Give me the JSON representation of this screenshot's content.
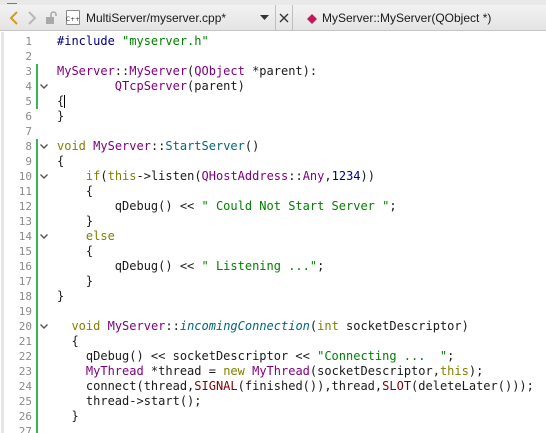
{
  "toolbar": {
    "file_name": "MultiServer/myserver.cpp*",
    "file_icon_text": "C++",
    "symbol": "MyServer::MyServer(QObject *)"
  },
  "lines": [
    {
      "n": "1",
      "change": false,
      "fold": false,
      "tokens": [
        {
          "t": "#include ",
          "c": "pp"
        },
        {
          "t": "\"myserver.h\"",
          "c": "pp-str"
        }
      ]
    },
    {
      "n": "2",
      "change": false,
      "fold": false,
      "tokens": []
    },
    {
      "n": "3",
      "change": true,
      "fold": false,
      "tokens": [
        {
          "t": "MyServer",
          "c": "type"
        },
        {
          "t": "::",
          "c": "plain"
        },
        {
          "t": "MyServer",
          "c": "type"
        },
        {
          "t": "(",
          "c": "plain"
        },
        {
          "t": "QObject",
          "c": "type"
        },
        {
          "t": " *parent):",
          "c": "plain"
        }
      ]
    },
    {
      "n": "4",
      "change": true,
      "fold": true,
      "tokens": [
        {
          "t": "        ",
          "c": "plain"
        },
        {
          "t": "QTcpServer",
          "c": "type"
        },
        {
          "t": "(parent)",
          "c": "plain"
        }
      ]
    },
    {
      "n": "5",
      "change": true,
      "fold": false,
      "cursor": true,
      "tokens": [
        {
          "t": "{",
          "c": "plain"
        }
      ]
    },
    {
      "n": "6",
      "change": false,
      "fold": false,
      "tokens": [
        {
          "t": "}",
          "c": "plain"
        }
      ]
    },
    {
      "n": "7",
      "change": false,
      "fold": false,
      "tokens": []
    },
    {
      "n": "8",
      "change": true,
      "fold": true,
      "tokens": [
        {
          "t": "void",
          "c": "kw"
        },
        {
          "t": " ",
          "c": "plain"
        },
        {
          "t": "MyServer",
          "c": "type"
        },
        {
          "t": "::",
          "c": "plain"
        },
        {
          "t": "StartServer",
          "c": "fn"
        },
        {
          "t": "()",
          "c": "plain"
        }
      ]
    },
    {
      "n": "9",
      "change": true,
      "fold": false,
      "tokens": [
        {
          "t": "{",
          "c": "plain"
        }
      ]
    },
    {
      "n": "10",
      "change": true,
      "fold": true,
      "tokens": [
        {
          "t": "    ",
          "c": "plain"
        },
        {
          "t": "if",
          "c": "kw"
        },
        {
          "t": "(",
          "c": "plain"
        },
        {
          "t": "this",
          "c": "kw"
        },
        {
          "t": "->",
          "c": "plain"
        },
        {
          "t": "listen",
          "c": "plain"
        },
        {
          "t": "(",
          "c": "plain"
        },
        {
          "t": "QHostAddress",
          "c": "type"
        },
        {
          "t": "::",
          "c": "plain"
        },
        {
          "t": "Any",
          "c": "type"
        },
        {
          "t": ",",
          "c": "plain"
        },
        {
          "t": "1234",
          "c": "num"
        },
        {
          "t": "))",
          "c": "plain"
        }
      ]
    },
    {
      "n": "11",
      "change": true,
      "fold": false,
      "tokens": [
        {
          "t": "    {",
          "c": "plain"
        }
      ]
    },
    {
      "n": "12",
      "change": true,
      "fold": false,
      "tokens": [
        {
          "t": "        qDebug() << ",
          "c": "plain"
        },
        {
          "t": "\" Could Not Start Server \"",
          "c": "str"
        },
        {
          "t": ";",
          "c": "plain"
        }
      ]
    },
    {
      "n": "13",
      "change": true,
      "fold": false,
      "tokens": [
        {
          "t": "    }",
          "c": "plain"
        }
      ]
    },
    {
      "n": "14",
      "change": true,
      "fold": true,
      "tokens": [
        {
          "t": "    ",
          "c": "plain"
        },
        {
          "t": "else",
          "c": "kw"
        }
      ]
    },
    {
      "n": "15",
      "change": true,
      "fold": false,
      "tokens": [
        {
          "t": "    {",
          "c": "plain"
        }
      ]
    },
    {
      "n": "16",
      "change": true,
      "fold": false,
      "tokens": [
        {
          "t": "        qDebug() << ",
          "c": "plain"
        },
        {
          "t": "\" Listening ...\"",
          "c": "str"
        },
        {
          "t": ";",
          "c": "plain"
        }
      ]
    },
    {
      "n": "17",
      "change": true,
      "fold": false,
      "tokens": [
        {
          "t": "    }",
          "c": "plain"
        }
      ]
    },
    {
      "n": "18",
      "change": true,
      "fold": false,
      "tokens": [
        {
          "t": "}",
          "c": "plain"
        }
      ]
    },
    {
      "n": "19",
      "change": true,
      "fold": false,
      "tokens": []
    },
    {
      "n": "20",
      "change": true,
      "fold": true,
      "tokens": [
        {
          "t": "  ",
          "c": "plain"
        },
        {
          "t": "void",
          "c": "kw"
        },
        {
          "t": " ",
          "c": "plain"
        },
        {
          "t": "MyServer",
          "c": "type"
        },
        {
          "t": "::",
          "c": "plain"
        },
        {
          "t": "incomingConnection",
          "c": "it"
        },
        {
          "t": "(",
          "c": "plain"
        },
        {
          "t": "int",
          "c": "kw"
        },
        {
          "t": " socketDescriptor)",
          "c": "plain"
        }
      ]
    },
    {
      "n": "21",
      "change": true,
      "fold": false,
      "tokens": [
        {
          "t": "  {",
          "c": "plain"
        }
      ]
    },
    {
      "n": "22",
      "change": true,
      "fold": false,
      "tokens": [
        {
          "t": "    qDebug() << socketDescriptor << ",
          "c": "plain"
        },
        {
          "t": "\"Connecting ...  \"",
          "c": "str"
        },
        {
          "t": ";",
          "c": "plain"
        }
      ]
    },
    {
      "n": "23",
      "change": true,
      "fold": false,
      "tokens": [
        {
          "t": "    ",
          "c": "plain"
        },
        {
          "t": "MyThread",
          "c": "type"
        },
        {
          "t": " *thread = ",
          "c": "plain"
        },
        {
          "t": "new",
          "c": "kw"
        },
        {
          "t": " ",
          "c": "plain"
        },
        {
          "t": "MyThread",
          "c": "type"
        },
        {
          "t": "(socketDescriptor,",
          "c": "plain"
        },
        {
          "t": "this",
          "c": "kw"
        },
        {
          "t": ");",
          "c": "plain"
        }
      ]
    },
    {
      "n": "24",
      "change": true,
      "fold": false,
      "tokens": [
        {
          "t": "    connect(thread,",
          "c": "plain"
        },
        {
          "t": "SIGNAL",
          "c": "member"
        },
        {
          "t": "(finished()),thread,",
          "c": "plain"
        },
        {
          "t": "SLOT",
          "c": "member"
        },
        {
          "t": "(deleteLater()));",
          "c": "plain"
        }
      ]
    },
    {
      "n": "25",
      "change": true,
      "fold": false,
      "tokens": [
        {
          "t": "    thread->start();",
          "c": "plain"
        }
      ]
    },
    {
      "n": "26",
      "change": true,
      "fold": false,
      "tokens": [
        {
          "t": "  }",
          "c": "plain"
        }
      ]
    },
    {
      "n": "27",
      "change": true,
      "fold": false,
      "tokens": []
    }
  ]
}
